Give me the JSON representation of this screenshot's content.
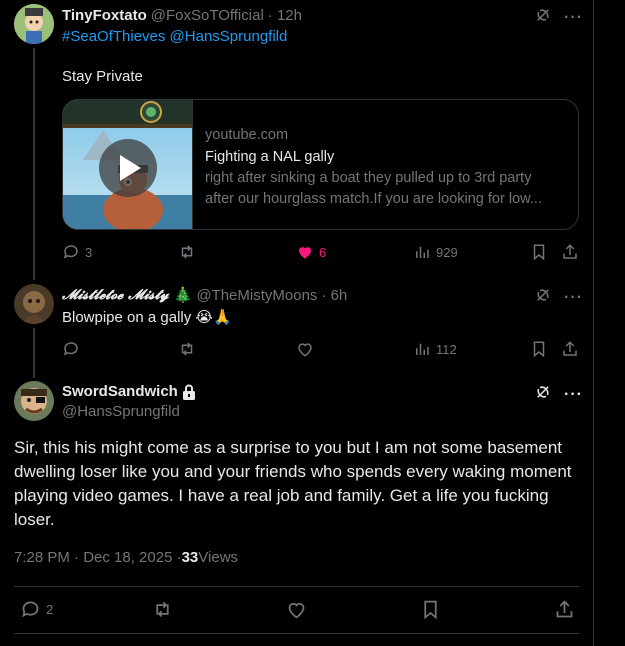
{
  "tweet1": {
    "display_name": "TinyFoxtato",
    "handle": "@FoxSoTOfficial",
    "time": "· 12h",
    "hashtags": "#SeaOfThieves @HansSprungfild",
    "text": "Stay Private",
    "card": {
      "domain": "youtube.com",
      "title": "Fighting a NAL gally",
      "description_line1": "right after sinking a boat they pulled up to 3rd party",
      "description_line2": "after our hourglass match.If you are looking for low..."
    },
    "replies": "3",
    "reposts": "",
    "likes": "6",
    "views": "929",
    "liked": true
  },
  "tweet2": {
    "display_name": "𝓜𝓲𝓼𝓽𝓵𝓮𝓽𝓸𝓮 𝓜𝓲𝓼𝓽𝔂",
    "tree_emoji": "🎄",
    "handle": "@TheMistyMoons",
    "time": "· 6h",
    "text": "Blowpipe on a gally 😭🙏",
    "replies": "",
    "reposts": "",
    "likes": "",
    "views": "112"
  },
  "main_tweet": {
    "display_name": "SwordSandwich",
    "handle": "@HansSprungfild",
    "text": "Sir, this his might come as a surprise to you but I am not some basement dwelling  loser like you and your friends who spends every waking moment playing video games. I have a real job and family. Get a life you fucking loser.",
    "timestamp": "7:28 PM · Dec 18, 2025 · ",
    "views_count": "33",
    "views_label": " Views",
    "replies": "2"
  },
  "icons": {
    "lock": "lock-icon",
    "grok": "grok-icon",
    "more": "more-icon"
  },
  "colors": {
    "accent": "#1d9bf0",
    "like": "#f91880",
    "muted": "#71767b"
  }
}
